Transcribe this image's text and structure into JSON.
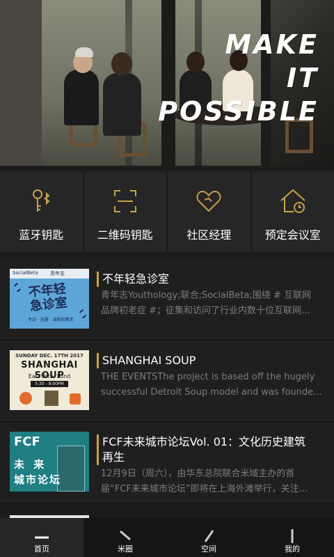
{
  "hero": {
    "tagline_line1": "MAKE",
    "tagline_line2": "IT",
    "tagline_line3": "POSSIBLE"
  },
  "actions": [
    {
      "label": "蓝牙钥匙",
      "icon": "bluetooth-key-icon"
    },
    {
      "label": "二维码钥匙",
      "icon": "qr-scan-icon"
    },
    {
      "label": "社区经理",
      "icon": "heart-icon"
    },
    {
      "label": "预定会议室",
      "icon": "house-clock-icon"
    }
  ],
  "feed": [
    {
      "title": "不年轻急诊室",
      "desc_line1": "青年志Youthology;联合;SocialBeta;围绕 # 互联网",
      "desc_line2": "品牌初老症 #；征集和访问了行业内数十位互联网…",
      "thumb": {
        "text1": "不年轻",
        "text2": "急诊室",
        "sub": "专访 · 无趣 · 油腻和晚老",
        "band_left": "SocialBeta",
        "band_right": "青年志"
      }
    },
    {
      "title": "SHANGHAI SOUP",
      "desc_line1": "THE EVENTSThe project is based off the hugely",
      "desc_line2": "successful Detroit Soup model and was founde…",
      "thumb": {
        "header": "SUNDAY DEC. 17TH 2017",
        "big": "SHANGHAI SOUP",
        "tag": "Eat. Vote. Fund",
        "time": "5:30 - 8:00PM"
      }
    },
    {
      "title_line1": "FCF未来城市论坛Vol. 01：文化历史建筑",
      "title_line2": "再生",
      "desc_line1": "12月9日（周六），由华东总院联合米域主办的首",
      "desc_line2": "届“FCF未来城市论坛”即将在上海外滩举行，关注…",
      "thumb": {
        "logo": "FCF",
        "line1": "未 来",
        "line2": "城市论坛"
      }
    }
  ],
  "nav": [
    {
      "label": "首页",
      "active": true
    },
    {
      "label": "米圈",
      "active": false
    },
    {
      "label": "空间",
      "active": false
    },
    {
      "label": "我的",
      "active": false
    }
  ],
  "colors": {
    "accent": "#c9a24a",
    "background": "#1c1c1c",
    "muted_text": "#7d7d7d"
  }
}
